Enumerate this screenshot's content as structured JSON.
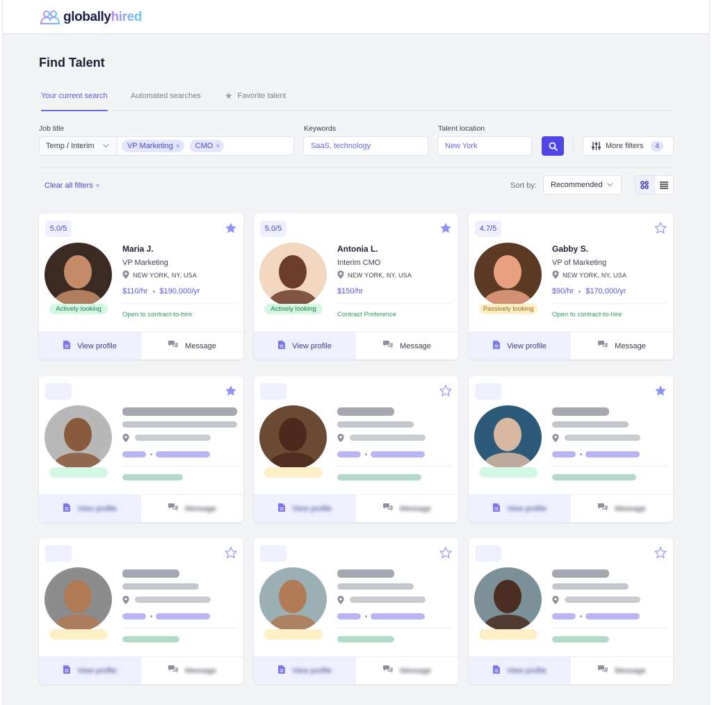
{
  "brand": {
    "name_part1": "globally",
    "name_part2": "hired"
  },
  "page": {
    "title": "Find Talent"
  },
  "tabs": [
    {
      "label": "Your current search",
      "active": true
    },
    {
      "label": "Automated searches",
      "active": false
    },
    {
      "label": "Favorite talent",
      "active": false,
      "icon": "star-icon"
    }
  ],
  "filters": {
    "job_title_label": "Job title",
    "job_type_value": "Temp / Interim",
    "job_title_chips": [
      "VP Marketing",
      "CMO"
    ],
    "keywords_label": "Keywords",
    "keywords_value": "SaaS, technology",
    "location_label": "Talent location",
    "location_value": "New York",
    "more_filters_label": "More filters",
    "more_filters_count": "4",
    "clear_all_label": "Clear all filters",
    "chip_remove_glyph": "×"
  },
  "sort": {
    "label": "Sort by:",
    "value": "Recommended"
  },
  "view_modes": {
    "active": "grid",
    "options": [
      "grid",
      "list"
    ]
  },
  "cards": [
    {
      "rating": "5.0/5",
      "favorited": true,
      "name": "Maria J.",
      "role": "VP Marketing",
      "location": "NEW YORK, NY, USA",
      "hourly": "$110/hr",
      "yearly": "$190,000/yr",
      "status": "Actively looking",
      "status_type": "active",
      "preference": "Open to contract-to-hire",
      "view_label": "View profile",
      "message_label": "Message"
    },
    {
      "rating": "5.0/5",
      "favorited": true,
      "name": "Antonia L.",
      "role": "Interim CMO",
      "location": "NEW YORK, NY, USA",
      "hourly": "$150/hr",
      "yearly": "",
      "status": "Actively looking",
      "status_type": "active",
      "preference": "Contract Preference",
      "view_label": "View profile",
      "message_label": "Message"
    },
    {
      "rating": "4.7/5",
      "favorited": false,
      "name": "Gabby S.",
      "role": "VP of Marketing",
      "location": "NEW YORK, NY, USA",
      "hourly": "$90/hr",
      "yearly": "$170,000/yr",
      "status": "Passively looking",
      "status_type": "passive",
      "preference": "Open to contract-to-hire",
      "view_label": "View profile",
      "message_label": "Message"
    }
  ],
  "placeholder_cards": [
    {
      "favorited": true,
      "status_type": "active",
      "view_label": "View profile",
      "message_label": "Message"
    },
    {
      "favorited": false,
      "status_type": "passive",
      "view_label": "View profile",
      "message_label": "Message"
    },
    {
      "favorited": true,
      "status_type": "active",
      "view_label": "View profile",
      "message_label": "Message"
    },
    {
      "favorited": false,
      "status_type": "passive",
      "view_label": "View profile",
      "message_label": "Message"
    },
    {
      "favorited": false,
      "status_type": "passive",
      "view_label": "View profile",
      "message_label": "Message"
    },
    {
      "favorited": false,
      "status_type": "passive",
      "view_label": "View profile",
      "message_label": "Message"
    }
  ],
  "colors": {
    "accent": "#4f46e5",
    "star_filled": "#8f93f5",
    "active_status_bg": "#d3f7e3",
    "passive_status_bg": "#fdf0c6"
  }
}
